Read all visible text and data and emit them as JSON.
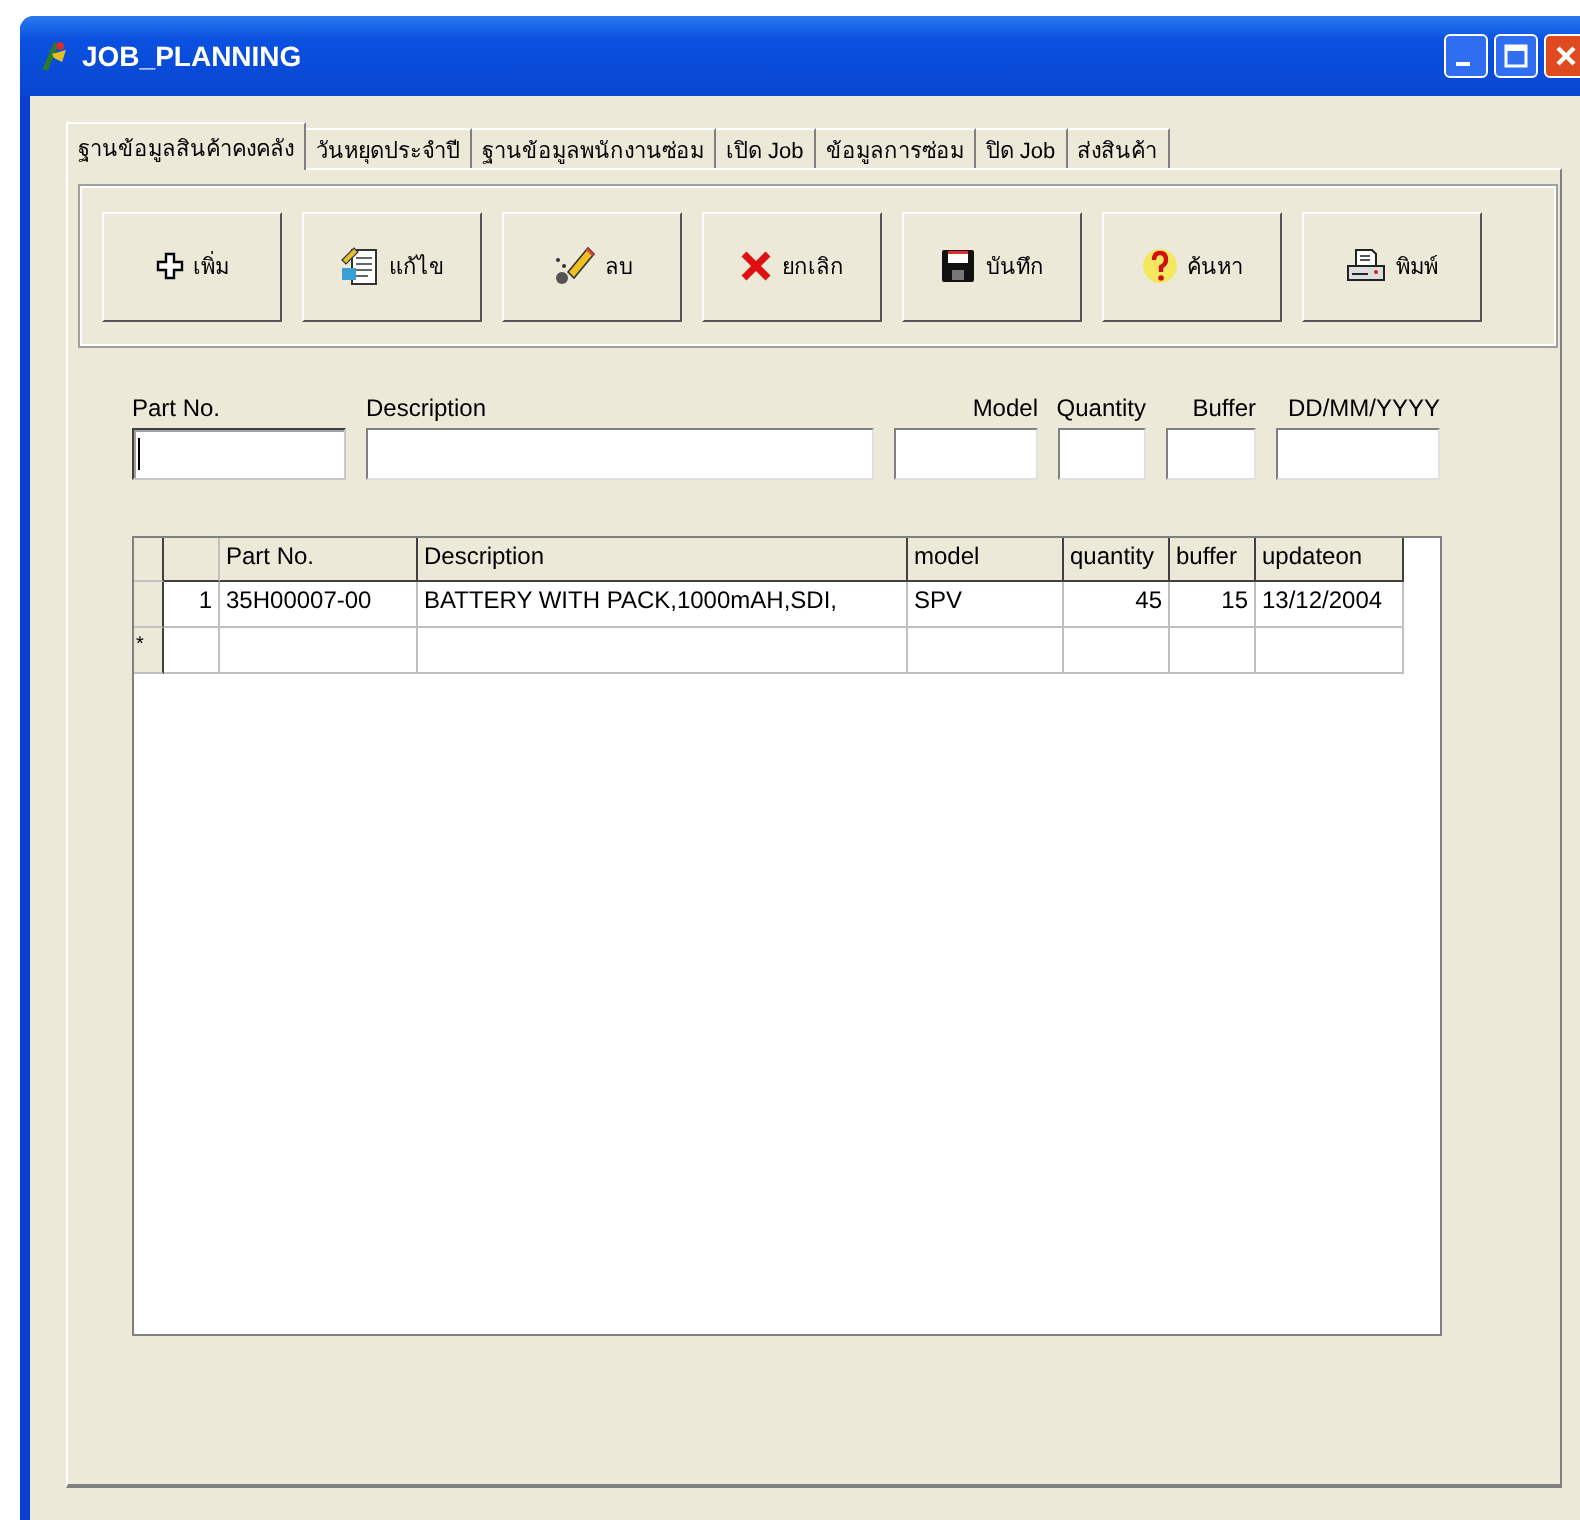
{
  "window": {
    "title": "JOB_PLANNING"
  },
  "tabs": [
    {
      "label": "ฐานข้อมูลสินค้าคงคลัง",
      "selected": true
    },
    {
      "label": "วันหยุดประจำปี",
      "selected": false
    },
    {
      "label": "ฐานข้อมูลพนักงานซ่อม",
      "selected": false
    },
    {
      "label": "เปิด Job",
      "selected": false
    },
    {
      "label": "ข้อมูลการซ่อม",
      "selected": false
    },
    {
      "label": "ปิด Job",
      "selected": false
    },
    {
      "label": "ส่งสินค้า",
      "selected": false
    }
  ],
  "toolbar": [
    {
      "label": "เพิ่ม",
      "kind": "add"
    },
    {
      "label": "แก้ไข",
      "kind": "edit"
    },
    {
      "label": "ลบ",
      "kind": "delete"
    },
    {
      "label": "ยกเลิก",
      "kind": "cancel"
    },
    {
      "label": "บันทึก",
      "kind": "save"
    },
    {
      "label": "ค้นหา",
      "kind": "search"
    },
    {
      "label": "พิมพ์",
      "kind": "print"
    }
  ],
  "fields": [
    {
      "label": "Part No.",
      "focused": true
    },
    {
      "label": "Description",
      "focused": false
    },
    {
      "label": "Model",
      "focused": false
    },
    {
      "label": "Quantity",
      "focused": false
    },
    {
      "label": "Buffer",
      "focused": false
    },
    {
      "label": "DD/MM/YYYY",
      "focused": false
    }
  ],
  "table": {
    "columns": [
      "Part No.",
      "Description",
      "model",
      "quantity",
      "buffer",
      "updateon"
    ],
    "rows": [
      {
        "number": "1",
        "cells": [
          "35H00007-00",
          "BATTERY WITH PACK,1000mAH,SDI,",
          "SPV",
          "45",
          "15",
          "13/12/2004"
        ]
      }
    ],
    "new_row_marker": "*"
  }
}
